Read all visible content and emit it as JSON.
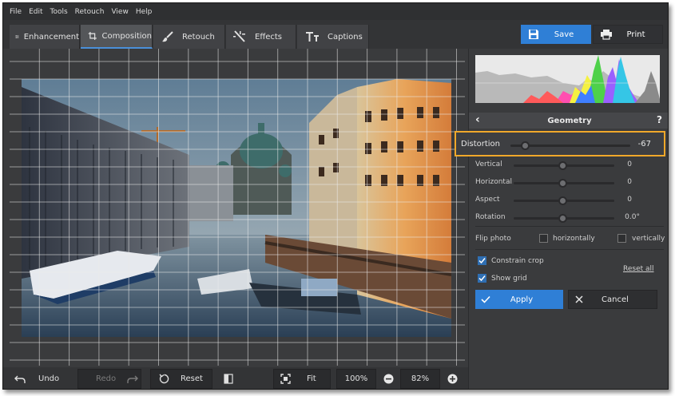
{
  "menu": [
    "File",
    "Edit",
    "Tools",
    "Retouch",
    "View",
    "Help"
  ],
  "tabs": [
    {
      "label": "Enhancement",
      "icon": "sliders-icon",
      "active": false
    },
    {
      "label": "Composition",
      "icon": "crop-icon",
      "active": true
    },
    {
      "label": "Retouch",
      "icon": "brush-icon",
      "active": false
    },
    {
      "label": "Effects",
      "icon": "magic-wand-icon",
      "active": false
    },
    {
      "label": "Captions",
      "icon": "text-icon",
      "active": false
    }
  ],
  "save_label": "Save",
  "print_label": "Print",
  "bottom": {
    "undo": "Undo",
    "redo": "Redo",
    "reset": "Reset",
    "fit": "Fit",
    "zoom100": "100%",
    "zoom_value": "82%"
  },
  "geometry": {
    "title": "Geometry",
    "help": "?",
    "sliders": [
      {
        "label": "Distortion",
        "value": "-67",
        "position": 0.13
      },
      {
        "label": "Vertical",
        "value": "0",
        "position": 0.5
      },
      {
        "label": "Horizontal",
        "value": "0",
        "position": 0.5
      },
      {
        "label": "Aspect",
        "value": "0",
        "position": 0.5
      },
      {
        "label": "Rotation",
        "value": "0.0°",
        "position": 0.5
      }
    ],
    "flip_label": "Flip photo",
    "flip_horizontal": "horizontally",
    "flip_vertical": "vertically",
    "constrain_crop": "Constrain crop",
    "show_grid": "Show grid",
    "reset_all": "Reset all",
    "apply": "Apply",
    "cancel": "Cancel"
  },
  "colors": {
    "accent": "#2f7fd6",
    "highlight": "#f0a82a",
    "panel_bg": "#3a3b3d"
  }
}
